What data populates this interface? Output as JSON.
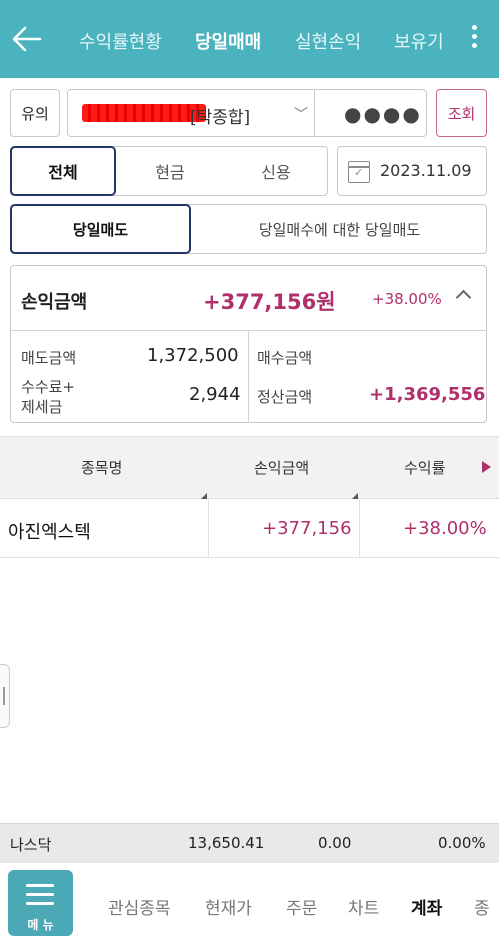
{
  "header": {
    "tabs": [
      {
        "label": "수익률현황",
        "active": false
      },
      {
        "label": "당일매매",
        "active": true
      },
      {
        "label": "실현손익",
        "active": false
      },
      {
        "label": "보유기",
        "active": false
      }
    ]
  },
  "account": {
    "type_button": "유의",
    "name_suffix": "[탁종합]",
    "password_mask": "●●●●",
    "query_button": "조회"
  },
  "filter": {
    "segments": [
      "전체",
      "현금",
      "신용"
    ],
    "selected": "전체",
    "date": "2023.11.09"
  },
  "trade_type": {
    "options": [
      "당일매도",
      "당일매수에 대한 당일매도"
    ],
    "selected": "당일매도"
  },
  "summary": {
    "pl_label": "손익금액",
    "pl_value": "+377,156원",
    "pl_rate": "+38.00%",
    "sell_label": "매도금액",
    "sell_value": "1,372,500",
    "buy_label": "매수금액",
    "buy_value": "",
    "fee_label_line1": "수수료+",
    "fee_label_line2": "제세금",
    "fee_value": "2,944",
    "settle_label": "정산금액",
    "settle_value": "+1,369,556"
  },
  "table": {
    "columns": [
      "종목명",
      "손익금액",
      "수익률"
    ],
    "rows": [
      {
        "name": "아진엑스텍",
        "pl": "+377,156",
        "rate": "+38.00%"
      }
    ]
  },
  "ticker": {
    "name": "나스닥",
    "value": "13,650.41",
    "change": "0.00",
    "rate": "0.00%"
  },
  "bottom_nav": {
    "menu_label": "메 뉴",
    "items": [
      {
        "label": "관심종목",
        "active": false
      },
      {
        "label": "현재가",
        "active": false
      },
      {
        "label": "주문",
        "active": false
      },
      {
        "label": "차트",
        "active": false
      },
      {
        "label": "계좌",
        "active": true
      },
      {
        "label": "종",
        "active": false
      }
    ]
  },
  "colors": {
    "header_bg": "#4bb3be",
    "accent_pink": "#b0306a",
    "selected_border": "#25366b"
  }
}
